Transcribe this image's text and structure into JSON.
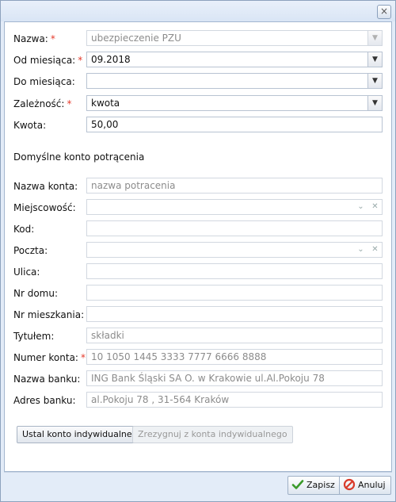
{
  "window": {
    "close_glyph": "×"
  },
  "form": {
    "nazwa": {
      "label": "Nazwa:",
      "value": "ubezpieczenie PZU",
      "required_mark": "*"
    },
    "od_miesiaca": {
      "label": "Od miesiąca:",
      "value": "09.2018",
      "required_mark": "*"
    },
    "do_miesiaca": {
      "label": "Do miesiąca:",
      "value": ""
    },
    "zaleznosc": {
      "label": "Zależność:",
      "value": "kwota",
      "required_mark": "*"
    },
    "kwota": {
      "label": "Kwota:",
      "value": "50,00"
    }
  },
  "section": {
    "title": "Domyślne konto potrącenia"
  },
  "account": {
    "nazwa_konta": {
      "label": "Nazwa konta:",
      "value": "nazwa potracenia"
    },
    "miejscowosc": {
      "label": "Miejscowość:",
      "value": ""
    },
    "kod": {
      "label": "Kod:",
      "value": ""
    },
    "poczta": {
      "label": "Poczta:",
      "value": ""
    },
    "ulica": {
      "label": "Ulica:",
      "value": ""
    },
    "nr_domu": {
      "label": "Nr domu:",
      "value": ""
    },
    "nr_mieszkania": {
      "label": "Nr mieszkania:",
      "value": ""
    },
    "tytulem": {
      "label": "Tytułem:",
      "value": "składki"
    },
    "numer_konta": {
      "label": "Numer konta:",
      "value": "10 1050 1445 3333 7777 6666 8888",
      "required_mark": "*"
    },
    "nazwa_banku": {
      "label": "Nazwa banku:",
      "value": "ING Bank Śląski SA  O. w Krakowie ul.Al.Pokoju 78"
    },
    "adres_banku": {
      "label": "Adres banku:",
      "value": "al.Pokoju 78 , 31-564 Kraków"
    }
  },
  "buttons": {
    "ustal": "Ustal konto indywidualne",
    "zrezygnuj": "Zrezygnuj z konta indywidualnego",
    "zapisz": "Zapisz",
    "anuluj": "Anuluj"
  },
  "icons": {
    "dropdown": "chevron-down-icon",
    "clear": "clear-icon",
    "save": "checkmark-icon",
    "cancel": "cancel-icon"
  },
  "colors": {
    "required": "#e53b2c",
    "frame": "#e3ecf8",
    "border": "#8da2bd"
  }
}
